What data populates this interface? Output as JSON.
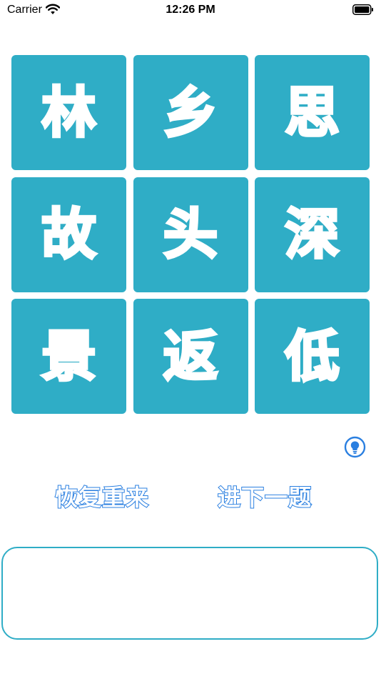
{
  "status_bar": {
    "carrier": "Carrier",
    "time": "12:26 PM"
  },
  "grid": {
    "tiles": [
      "林",
      "乡",
      "思",
      "故",
      "头",
      "深",
      "景",
      "返",
      "低"
    ]
  },
  "actions": {
    "restore_label": "恢复重来",
    "next_label": "进下一题"
  },
  "colors": {
    "tile": "#2fadc6",
    "accent": "#2a7fe0"
  },
  "icons": {
    "hint": "lightbulb-icon",
    "wifi": "wifi-icon",
    "battery": "battery-icon"
  }
}
